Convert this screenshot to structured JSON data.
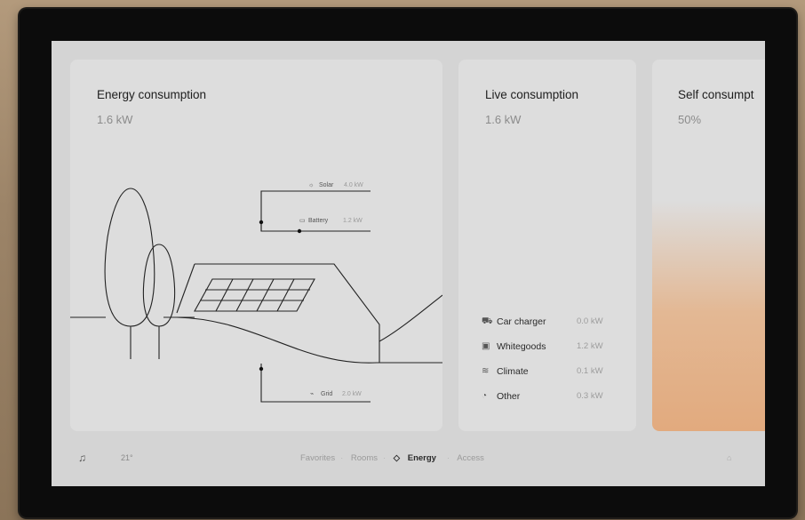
{
  "cards": {
    "energy": {
      "title": "Energy consumption",
      "value": "1.6 kW"
    },
    "live": {
      "title": "Live consumption",
      "value": "1.6 kW"
    },
    "self": {
      "title": "Self consumpt",
      "value": "50%"
    }
  },
  "sources": [
    {
      "label": "Solar",
      "value": "4.0 kW"
    },
    {
      "label": "Battery",
      "value": "1.2 kW"
    },
    {
      "label": "Grid",
      "value": "2.0 kW"
    }
  ],
  "live_items": [
    {
      "icon": "car-icon",
      "label": "Car charger",
      "value": "0.0 kW"
    },
    {
      "icon": "washer-icon",
      "label": "Whitegoods",
      "value": "1.2 kW"
    },
    {
      "icon": "climate-icon",
      "label": "Climate",
      "value": "0.1 kW"
    },
    {
      "icon": "other-icon",
      "label": "Other",
      "value": "0.3 kW"
    }
  ],
  "bottom_bar": {
    "temperature": "21°",
    "nav": [
      "Favorites",
      "Rooms",
      "Energy",
      "Access"
    ],
    "active": "Energy",
    "right_label": "⌂"
  },
  "colors": {
    "accent_gradient": "#e2aa7e",
    "screen_bg": "#d4d4d4",
    "card_bg": "#dddddd"
  }
}
